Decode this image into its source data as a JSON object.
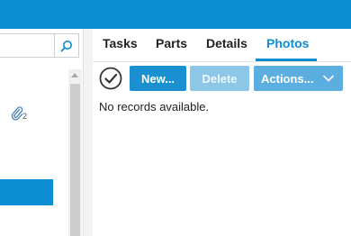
{
  "colors": {
    "brand": "#0b8ed4",
    "button_new": "#1a90d0",
    "button_delete_disabled": "#8cc7e7",
    "button_actions": "#5aaee0"
  },
  "left_pane": {
    "search": {
      "value": "",
      "placeholder": "",
      "button_icon": "search-icon"
    },
    "list": {
      "attachment_count": "2",
      "attachment_icon": "paperclip-icon"
    }
  },
  "tabs": [
    {
      "label": "Tasks",
      "active": false
    },
    {
      "label": "Parts",
      "active": false
    },
    {
      "label": "Details",
      "active": false
    },
    {
      "label": "Photos",
      "active": true
    }
  ],
  "toolbar": {
    "select_all_icon": "check-circle-icon",
    "new_label": "New...",
    "delete_label": "Delete",
    "actions_label": "Actions...",
    "actions_icon": "chevron-down-icon"
  },
  "content": {
    "empty_message": "No records available."
  }
}
